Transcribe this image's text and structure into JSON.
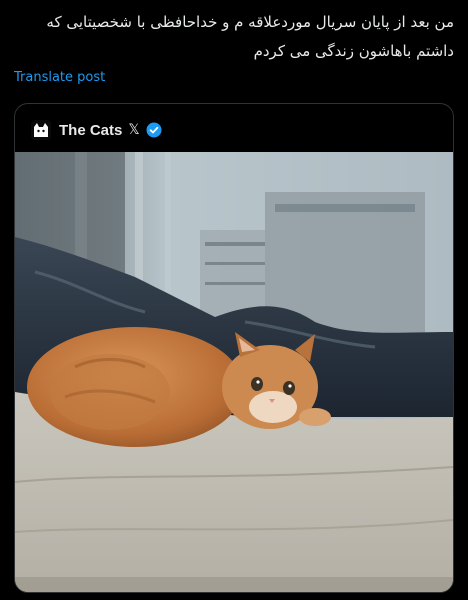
{
  "post": {
    "text_line_1": "من بعد از پایان سریال موردعلاقه م و خداحافظی با شخصیتایی که",
    "text_line_2": "داشتم باهاشون زندگی می کردم",
    "translate_label": "Translate post"
  },
  "quoted_post": {
    "account_name": "The Cats",
    "account_badge": "𝕏",
    "verified_icon": "verified-badge-icon",
    "avatar_icon": "cat-silhouette-icon",
    "media_description_icon": "photo-orange-kitten-on-bed"
  },
  "colors": {
    "background": "#000000",
    "text": "#e7e9ea",
    "link": "#1d9bf0",
    "border": "#2f3336",
    "verified": "#1d9bf0"
  }
}
